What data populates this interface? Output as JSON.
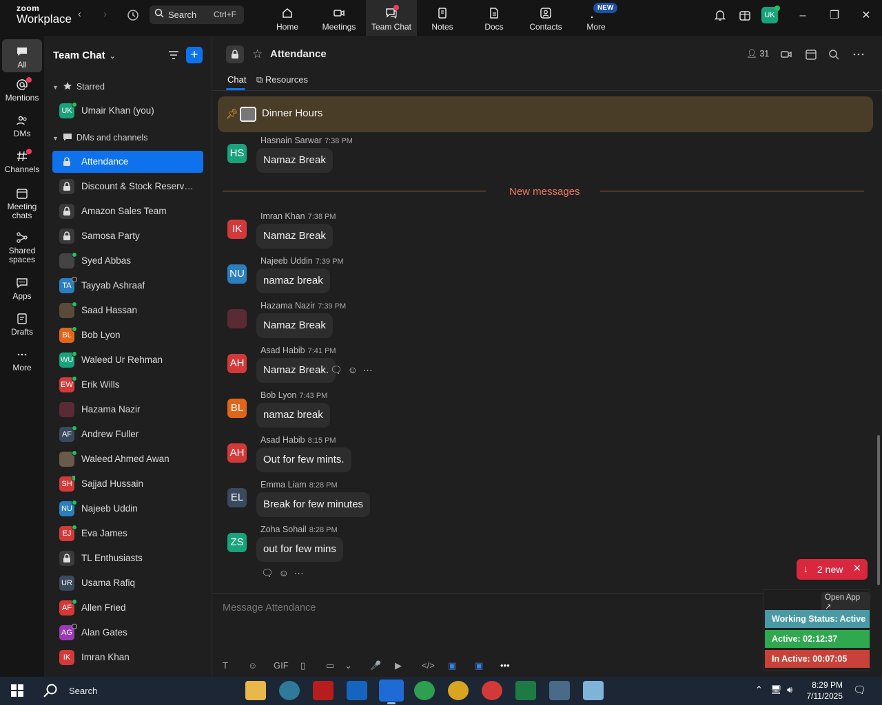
{
  "app": {
    "logo_line1": "zoom",
    "logo_line2": "Workplace"
  },
  "topbar": {
    "search_label": "Search",
    "search_shortcut": "Ctrl+F",
    "tabs": [
      {
        "label": "Home",
        "icon": "home-icon"
      },
      {
        "label": "Meetings",
        "icon": "video-icon"
      },
      {
        "label": "Team Chat",
        "icon": "chat-icon"
      },
      {
        "label": "Notes",
        "icon": "notes-icon"
      },
      {
        "label": "Docs",
        "icon": "docs-icon"
      },
      {
        "label": "Contacts",
        "icon": "contacts-icon"
      },
      {
        "label": "More",
        "icon": "more-icon"
      }
    ],
    "new_badge": "NEW",
    "user_initials": "UK"
  },
  "rail": [
    {
      "label": "All",
      "icon": "chat-bubble-icon"
    },
    {
      "label": "Mentions",
      "icon": "at-icon"
    },
    {
      "label": "DMs",
      "icon": "people-icon"
    },
    {
      "label": "Channels",
      "icon": "hash-icon"
    },
    {
      "label": "Meeting chats",
      "icon": "calendar-icon"
    },
    {
      "label": "Shared spaces",
      "icon": "share-icon"
    },
    {
      "label": "Apps",
      "icon": "apps-icon"
    },
    {
      "label": "Drafts",
      "icon": "drafts-icon"
    },
    {
      "label": "More",
      "icon": "ellipsis-icon"
    }
  ],
  "sidebar": {
    "title": "Team Chat",
    "starred_label": "Starred",
    "dms_label": "DMs and channels",
    "starred": [
      {
        "name": "Umair Khan (you)",
        "initials": "UK",
        "color": "#1aa37a",
        "presence": "online"
      }
    ],
    "items": [
      {
        "name": "Attendance",
        "type": "channel",
        "active": true
      },
      {
        "name": "Discount & Stock Reservati...",
        "type": "channel"
      },
      {
        "name": "Amazon Sales Team",
        "type": "channel"
      },
      {
        "name": "Samosa Party",
        "type": "channel"
      },
      {
        "name": "Syed Abbas",
        "type": "dm",
        "initials": "",
        "color": "#444444",
        "presence": "online"
      },
      {
        "name": "Tayyab Ashraaf",
        "type": "dm",
        "initials": "TA",
        "color": "#2b7fbf",
        "presence": "away"
      },
      {
        "name": "Saad Hassan",
        "type": "dm",
        "initials": "",
        "color": "#5a4a3a",
        "presence": "online"
      },
      {
        "name": "Bob Lyon",
        "type": "dm",
        "initials": "BL",
        "color": "#e0661a",
        "presence": "online"
      },
      {
        "name": "Waleed Ur Rehman",
        "type": "dm",
        "initials": "WU",
        "color": "#1aa37a",
        "presence": "online"
      },
      {
        "name": "Erik Wills",
        "type": "dm",
        "initials": "EW",
        "color": "#d23a3a",
        "presence": "online"
      },
      {
        "name": "Hazama Nazir",
        "type": "dm",
        "initials": "",
        "color": "#5a2a35",
        "presence": "none"
      },
      {
        "name": "Andrew Fuller",
        "type": "dm",
        "initials": "AF",
        "color": "#3a4a5e",
        "presence": "online"
      },
      {
        "name": "Waleed Ahmed Awan",
        "type": "dm",
        "initials": "",
        "color": "#6a5a4a",
        "presence": "online"
      },
      {
        "name": "Sajjad Hussain",
        "type": "dm",
        "initials": "SH",
        "color": "#d23a3a",
        "presence": "mobile"
      },
      {
        "name": "Najeeb Uddin",
        "type": "dm",
        "initials": "NU",
        "color": "#2b7fbf",
        "presence": "online"
      },
      {
        "name": "Eva James",
        "type": "dm",
        "initials": "EJ",
        "color": "#d23a3a",
        "presence": "online"
      },
      {
        "name": "TL Enthusiasts",
        "type": "channel"
      },
      {
        "name": "Usama Rafiq",
        "type": "dm",
        "initials": "UR",
        "color": "#3a4a5e",
        "presence": "none"
      },
      {
        "name": "Allen Fried",
        "type": "dm",
        "initials": "AF",
        "color": "#d23a3a",
        "presence": "online"
      },
      {
        "name": "Alan Gates",
        "type": "dm",
        "initials": "AG",
        "color": "#9b3ab5",
        "presence": "away"
      },
      {
        "name": "Imran Khan",
        "type": "dm",
        "initials": "IK",
        "color": "#d23a3a",
        "presence": "none"
      }
    ]
  },
  "channel": {
    "title": "Attendance",
    "members": "31",
    "tabs": [
      "Chat",
      "Resources"
    ],
    "pinned": "Dinner Hours",
    "new_messages_label": "New messages",
    "new_pill": "2 new",
    "composer_placeholder": "Message Attendance",
    "composer_tools": [
      "T",
      "☺",
      "GIF",
      "▯",
      "▭",
      "⌄",
      "🎤",
      "▶",
      "</>",
      "▣",
      "▣",
      "•••"
    ],
    "messages": [
      {
        "author": "Hasnain Sarwar",
        "time": "7:38 PM",
        "text": "Namaz Break",
        "initials": "HS",
        "color": "#1aa37a"
      },
      {
        "author": "Imran Khan",
        "time": "7:38 PM",
        "text": "Namaz Break",
        "initials": "IK",
        "color": "#d23a3a"
      },
      {
        "author": "Najeeb Uddin",
        "time": "7:39 PM",
        "text": "namaz break",
        "initials": "NU",
        "color": "#2b7fbf"
      },
      {
        "author": "Hazama Nazir",
        "time": "7:39 PM",
        "text": "Namaz Break",
        "initials": "",
        "color": "#5a2a35"
      },
      {
        "author": "Asad Habib",
        "time": "7:41 PM",
        "text": "Namaz Break.",
        "initials": "AH",
        "color": "#d23a3a"
      },
      {
        "author": "Bob Lyon",
        "time": "7:43 PM",
        "text": "namaz break",
        "initials": "BL",
        "color": "#e0661a"
      },
      {
        "author": "Asad Habib",
        "time": "8:15 PM",
        "text": "Out for few mints.",
        "initials": "AH",
        "color": "#d23a3a"
      },
      {
        "author": "Emma Liam",
        "time": "8:28 PM",
        "text": "Break for few minutes",
        "initials": "EL",
        "color": "#3a4a5e"
      },
      {
        "author": "Zoha Sohail",
        "time": "8:28 PM",
        "text": "out for few mins",
        "initials": "ZS",
        "color": "#1aa37a"
      }
    ]
  },
  "widget": {
    "open_app": "Open App ↗",
    "status": "Working Status: Active",
    "active": "Active: 02:12:37",
    "inactive": "In Active: 00:07:05",
    "colors": {
      "status": "#4a9aa5",
      "active": "#2fa84f",
      "inactive": "#c9423a"
    }
  },
  "taskbar": {
    "search_label": "Search",
    "time": "8:29 PM",
    "date": "7/11/2025"
  }
}
